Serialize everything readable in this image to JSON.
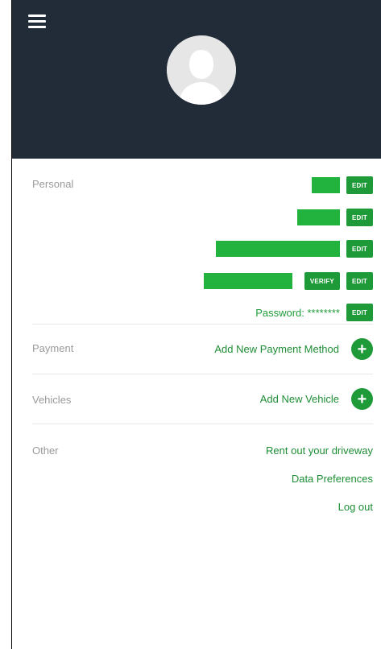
{
  "header": {
    "menu_icon": "hamburger-icon",
    "avatar_icon": "user-silhouette-icon",
    "colors": {
      "background": "#222c39",
      "avatar_bg": "#e6e6e6"
    }
  },
  "personal": {
    "label": "Personal",
    "edit_label": "EDIT",
    "verify_label": "VERIFY",
    "password_label": "Password: ********"
  },
  "payment": {
    "label": "Payment",
    "action": "Add New Payment Method"
  },
  "vehicles": {
    "label": "Vehicles",
    "action": "Add New Vehicle"
  },
  "other": {
    "label": "Other",
    "links": [
      "Rent out your driveway",
      "Data Preferences",
      "Log out"
    ]
  },
  "colors": {
    "accent": "#1e9a38",
    "redaction": "#22b33f",
    "muted_label": "#9a9a9a"
  },
  "icons": {
    "plus": "+"
  }
}
